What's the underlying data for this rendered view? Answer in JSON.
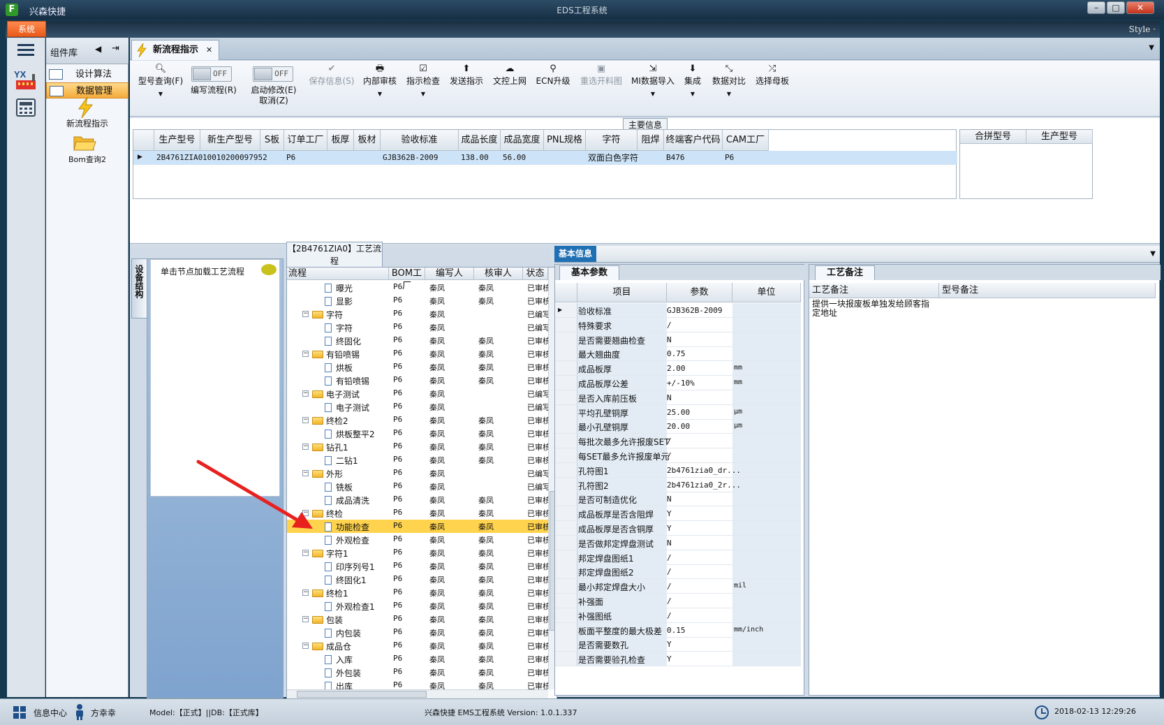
{
  "window": {
    "app_name": "兴森快捷",
    "title": "EDS工程系统",
    "min": "–",
    "max": "□",
    "close": "✕"
  },
  "menu": {
    "system": "系统",
    "style": "Style ·"
  },
  "left_bar": {
    "logo_text": "YX"
  },
  "library": {
    "title": "组件库",
    "items": [
      {
        "label": "设计算法"
      },
      {
        "label": "数据管理"
      }
    ],
    "tools": [
      {
        "label": "新流程指示"
      },
      {
        "label": "Bom查询2"
      }
    ]
  },
  "tab": {
    "label": "新流程指示",
    "close": "✕"
  },
  "toolbar": {
    "buttons": [
      {
        "label": "型号查询(F)",
        "icon": "search-icon"
      },
      {
        "label": "编写流程(R)",
        "toggle": "OFF"
      },
      {
        "label": "启动修改(E)",
        "label2": "取消(Z)",
        "toggle": "OFF"
      },
      {
        "label": "保存信息(S)",
        "icon": "check-icon",
        "disabled": true
      },
      {
        "label": "内部审核",
        "icon": "print-icon"
      },
      {
        "label": "指示检查",
        "icon": "checkbox-icon"
      },
      {
        "label": "发送指示",
        "icon": "upload-icon"
      },
      {
        "label": "文控上网",
        "icon": "cloud-upload-icon"
      },
      {
        "label": "ECN升级",
        "icon": "binoculars-icon"
      },
      {
        "label": "重选开料图",
        "icon": "image-icon",
        "disabled": true
      },
      {
        "label": "MI数据导入",
        "icon": "import-icon"
      },
      {
        "label": "集成",
        "icon": "download-icon"
      },
      {
        "label": "数据对比",
        "icon": "compare-icon"
      },
      {
        "label": "选择母板",
        "icon": "shuffle-icon"
      }
    ]
  },
  "main_info": {
    "title": "主要信息",
    "columns": [
      "生产型号",
      "新生产型号",
      "S板",
      "订单工厂",
      "板厚",
      "板材",
      "验收标准",
      "成品长度",
      "成品宽度",
      "PNL规格",
      "字符",
      "阻焊",
      "终端客户代码",
      "CAM工厂"
    ],
    "row": [
      "2B4761ZIA0",
      "10010200097952",
      "",
      "P6",
      "",
      "",
      "GJB362B-2009",
      "138.00",
      "56.00",
      "",
      "双面白色字符",
      "",
      "B476",
      "P6"
    ],
    "side_columns": [
      "合拼型号",
      "生产型号"
    ]
  },
  "process": {
    "title": "【2B4761ZIA0】工艺流程",
    "vertical_tab": "设备结构",
    "hint": "单击节点加载工艺流程",
    "columns": [
      "流程",
      "BOM工厂",
      "编写人",
      "核审人",
      "状态"
    ],
    "rows": [
      {
        "name": "曝光",
        "level": 2,
        "bom": "P6",
        "writer": "秦凤",
        "reviewer": "秦凤",
        "status": "已审核"
      },
      {
        "name": "显影",
        "level": 2,
        "bom": "P6",
        "writer": "秦凤",
        "reviewer": "秦凤",
        "status": "已审核"
      },
      {
        "name": "字符",
        "level": 1,
        "bom": "P6",
        "writer": "秦凤",
        "reviewer": "",
        "status": "已编写"
      },
      {
        "name": "字符",
        "level": 2,
        "bom": "P6",
        "writer": "秦凤",
        "reviewer": "",
        "status": "已编写"
      },
      {
        "name": "终固化",
        "level": 2,
        "bom": "P6",
        "writer": "秦凤",
        "reviewer": "秦凤",
        "status": "已审核"
      },
      {
        "name": "有铅喷锡",
        "level": 1,
        "bom": "P6",
        "writer": "秦凤",
        "reviewer": "秦凤",
        "status": "已审核"
      },
      {
        "name": "烘板",
        "level": 2,
        "bom": "P6",
        "writer": "秦凤",
        "reviewer": "秦凤",
        "status": "已审核"
      },
      {
        "name": "有铅喷锡",
        "level": 2,
        "bom": "P6",
        "writer": "秦凤",
        "reviewer": "秦凤",
        "status": "已审核"
      },
      {
        "name": "电子测试",
        "level": 1,
        "bom": "P6",
        "writer": "秦凤",
        "reviewer": "",
        "status": "已编写"
      },
      {
        "name": "电子测试",
        "level": 2,
        "bom": "P6",
        "writer": "秦凤",
        "reviewer": "",
        "status": "已编写"
      },
      {
        "name": "终检2",
        "level": 1,
        "bom": "P6",
        "writer": "秦凤",
        "reviewer": "秦凤",
        "status": "已审核"
      },
      {
        "name": "烘板整平2",
        "level": 2,
        "bom": "P6",
        "writer": "秦凤",
        "reviewer": "秦凤",
        "status": "已审核"
      },
      {
        "name": "钻孔1",
        "level": 1,
        "bom": "P6",
        "writer": "秦凤",
        "reviewer": "秦凤",
        "status": "已审核"
      },
      {
        "name": "二钻1",
        "level": 2,
        "bom": "P6",
        "writer": "秦凤",
        "reviewer": "秦凤",
        "status": "已审核"
      },
      {
        "name": "外形",
        "level": 1,
        "bom": "P6",
        "writer": "秦凤",
        "reviewer": "",
        "status": "已编写"
      },
      {
        "name": "铣板",
        "level": 2,
        "bom": "P6",
        "writer": "秦凤",
        "reviewer": "",
        "status": "已编写"
      },
      {
        "name": "成品清洗",
        "level": 2,
        "bom": "P6",
        "writer": "秦凤",
        "reviewer": "秦凤",
        "status": "已审核"
      },
      {
        "name": "终检",
        "level": 1,
        "bom": "P6",
        "writer": "秦凤",
        "reviewer": "秦凤",
        "status": "已审核"
      },
      {
        "name": "功能检查",
        "level": 2,
        "bom": "P6",
        "writer": "秦凤",
        "reviewer": "秦凤",
        "status": "已审核",
        "selected": true
      },
      {
        "name": "外观检查",
        "level": 2,
        "bom": "P6",
        "writer": "秦凤",
        "reviewer": "秦凤",
        "status": "已审核"
      },
      {
        "name": "字符1",
        "level": 1,
        "bom": "P6",
        "writer": "秦凤",
        "reviewer": "秦凤",
        "status": "已审核"
      },
      {
        "name": "印序列号1",
        "level": 2,
        "bom": "P6",
        "writer": "秦凤",
        "reviewer": "秦凤",
        "status": "已审核"
      },
      {
        "name": "终固化1",
        "level": 2,
        "bom": "P6",
        "writer": "秦凤",
        "reviewer": "秦凤",
        "status": "已审核"
      },
      {
        "name": "终检1",
        "level": 1,
        "bom": "P6",
        "writer": "秦凤",
        "reviewer": "秦凤",
        "status": "已审核"
      },
      {
        "name": "外观检查1",
        "level": 2,
        "bom": "P6",
        "writer": "秦凤",
        "reviewer": "秦凤",
        "status": "已审核"
      },
      {
        "name": "包装",
        "level": 1,
        "bom": "P6",
        "writer": "秦凤",
        "reviewer": "秦凤",
        "status": "已审核"
      },
      {
        "name": "内包装",
        "level": 2,
        "bom": "P6",
        "writer": "秦凤",
        "reviewer": "秦凤",
        "status": "已审核"
      },
      {
        "name": "成品仓",
        "level": 1,
        "bom": "P6",
        "writer": "秦凤",
        "reviewer": "秦凤",
        "status": "已审核"
      },
      {
        "name": "入库",
        "level": 2,
        "bom": "P6",
        "writer": "秦凤",
        "reviewer": "秦凤",
        "status": "已审核"
      },
      {
        "name": "外包装",
        "level": 2,
        "bom": "P6",
        "writer": "秦凤",
        "reviewer": "秦凤",
        "status": "已审核"
      },
      {
        "name": "出库",
        "level": 2,
        "bom": "P6",
        "writer": "秦凤",
        "reviewer": "秦凤",
        "status": "已审核"
      }
    ]
  },
  "basic_info": {
    "title": "基本信息",
    "params_tab": "基本参数",
    "columns": [
      "项目",
      "参数",
      "单位"
    ],
    "rows": [
      {
        "item": "验收标准",
        "value": "GJB362B-2009",
        "unit": ""
      },
      {
        "item": "特殊要求",
        "value": "/",
        "unit": ""
      },
      {
        "item": "是否需要翘曲检查",
        "value": "N",
        "unit": ""
      },
      {
        "item": "最大翘曲度",
        "value": "0.75",
        "unit": ""
      },
      {
        "item": "成品板厚",
        "value": "2.00",
        "unit": "mm"
      },
      {
        "item": "成品板厚公差",
        "value": "+/-10%",
        "unit": "mm"
      },
      {
        "item": "是否入库前压板",
        "value": "N",
        "unit": ""
      },
      {
        "item": "平均孔壁铜厚",
        "value": "25.00",
        "unit": "μm"
      },
      {
        "item": "最小孔壁铜厚",
        "value": "20.00",
        "unit": "μm"
      },
      {
        "item": "每批次最多允许报废SET",
        "value": "/",
        "unit": ""
      },
      {
        "item": "每SET最多允许报废单元",
        "value": "/",
        "unit": ""
      },
      {
        "item": "孔符图1",
        "value": "2b4761zia0_dr...",
        "unit": ""
      },
      {
        "item": "孔符图2",
        "value": "2b4761zia0_2r...",
        "unit": ""
      },
      {
        "item": "是否可制造优化",
        "value": "N",
        "unit": ""
      },
      {
        "item": "成品板厚是否含阻焊",
        "value": "Y",
        "unit": ""
      },
      {
        "item": "成品板厚是否含铜厚",
        "value": "Y",
        "unit": ""
      },
      {
        "item": "是否做邦定焊盘测试",
        "value": "N",
        "unit": ""
      },
      {
        "item": "邦定焊盘图纸1",
        "value": "/",
        "unit": ""
      },
      {
        "item": "邦定焊盘图纸2",
        "value": "/",
        "unit": ""
      },
      {
        "item": "最小邦定焊盘大小",
        "value": "/",
        "unit": "mil"
      },
      {
        "item": "补强面",
        "value": "/",
        "unit": ""
      },
      {
        "item": "补强图纸",
        "value": "/",
        "unit": ""
      },
      {
        "item": "板面平整度的最大极差",
        "value": "0.15",
        "unit": "mm/inch"
      },
      {
        "item": "是否需要数孔",
        "value": "Y",
        "unit": ""
      },
      {
        "item": "是否需要验孔检查",
        "value": "Y",
        "unit": ""
      }
    ],
    "notes_tab": "工艺备注",
    "notes_columns": [
      "工艺备注",
      "型号备注"
    ],
    "process_note": "提供一块报废板单独发给顾客指定地址",
    "model_note": ""
  },
  "status_bar": {
    "info_center": "信息中心",
    "user": "方幸幸",
    "model": "Model:【正式】||DB:【正式库】",
    "system": "兴森快捷 EMS工程系统 Version: 1.0.1.337",
    "datetime": "2018-02-13 12:29:26"
  },
  "colors": {
    "accent_orange": "#f07a3a",
    "selected_row": "#ffd34d",
    "header_blue": "#1f6fb3",
    "arrow_red": "#e8201e"
  }
}
